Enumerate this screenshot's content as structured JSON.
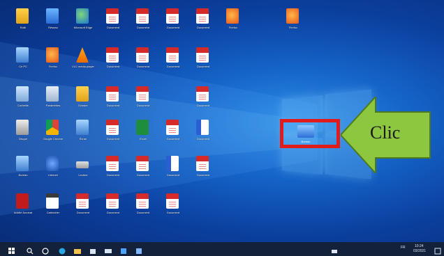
{
  "desktop": {
    "icons": [
      {
        "icon": "user-folder-icon",
        "label": "Ruth"
      },
      {
        "icon": "network-icon",
        "label": "Réseau"
      },
      {
        "icon": "edge-icon",
        "label": "Microsoft Edge"
      },
      {
        "icon": "pdf-document-icon",
        "label": "Document"
      },
      {
        "icon": "pdf-document-icon",
        "label": "Document"
      },
      {
        "icon": "pdf-document-icon",
        "label": "Document"
      },
      {
        "icon": "pdf-document-icon",
        "label": "Document"
      },
      {
        "icon": "firefox-icon",
        "label": "Firefox"
      },
      {
        "icon": "firefox-icon",
        "label": "Firefox"
      },
      {
        "icon": "monitor-icon",
        "label": "Ce PC"
      },
      {
        "icon": "firefox-icon",
        "label": "Firefox"
      },
      {
        "icon": "vlc-icon",
        "label": "VLC media player"
      },
      {
        "icon": "pdf-document-icon",
        "label": "Document"
      },
      {
        "icon": "pdf-document-icon",
        "label": "Document"
      },
      {
        "icon": "pdf-document-icon",
        "label": "Document"
      },
      {
        "icon": "pdf-document-icon",
        "label": "Document"
      },
      {
        "icon": "recycle-bin-icon",
        "label": "Corbeille"
      },
      {
        "icon": "settings-icon",
        "label": "Paramètres"
      },
      {
        "icon": "user-folder-icon",
        "label": "Dossier"
      },
      {
        "icon": "pdf-document-icon",
        "label": "Document"
      },
      {
        "icon": "pdf-document-icon",
        "label": "Document"
      },
      {
        "icon": "pdf-document-icon",
        "label": "Document"
      },
      {
        "icon": "disk-icon",
        "label": "Disque"
      },
      {
        "icon": "chrome-icon",
        "label": "Google Chrome"
      },
      {
        "icon": "monitor-icon",
        "label": "Écran"
      },
      {
        "icon": "pdf-document-icon",
        "label": "Document"
      },
      {
        "icon": "excel-icon",
        "label": "Excel"
      },
      {
        "icon": "pdf-document-icon",
        "label": "Document"
      },
      {
        "icon": "word-document-icon",
        "label": "Document"
      },
      {
        "icon": "monitor-icon",
        "label": "Bureau"
      },
      {
        "icon": "globe-icon",
        "label": "Internet"
      },
      {
        "icon": "drive-icon",
        "label": "Lecteur"
      },
      {
        "icon": "pdf-document-icon",
        "label": "Document"
      },
      {
        "icon": "pdf-document-icon",
        "label": "Document"
      },
      {
        "icon": "word-document-icon",
        "label": "Document"
      },
      {
        "icon": "pdf-document-icon",
        "label": "Document"
      },
      {
        "icon": "acrobat-icon",
        "label": "Adobe Acrobat"
      },
      {
        "icon": "calendar-icon",
        "label": "Calendrier"
      },
      {
        "icon": "pdf-document-icon",
        "label": "Document"
      },
      {
        "icon": "pdf-document-icon",
        "label": "Document"
      },
      {
        "icon": "pdf-document-icon",
        "label": "Document"
      },
      {
        "icon": "pdf-document-icon",
        "label": "Document"
      }
    ],
    "highlighted_icon": {
      "icon": "monitor-icon",
      "label": "Bureau"
    }
  },
  "callout": {
    "text": "Clic",
    "arrow_color": "#8dc63f",
    "box_color": "#e01b1b"
  },
  "taskbar": {
    "tray_text": "FR",
    "clock_time": "10:24",
    "clock_date": "03/2021"
  }
}
